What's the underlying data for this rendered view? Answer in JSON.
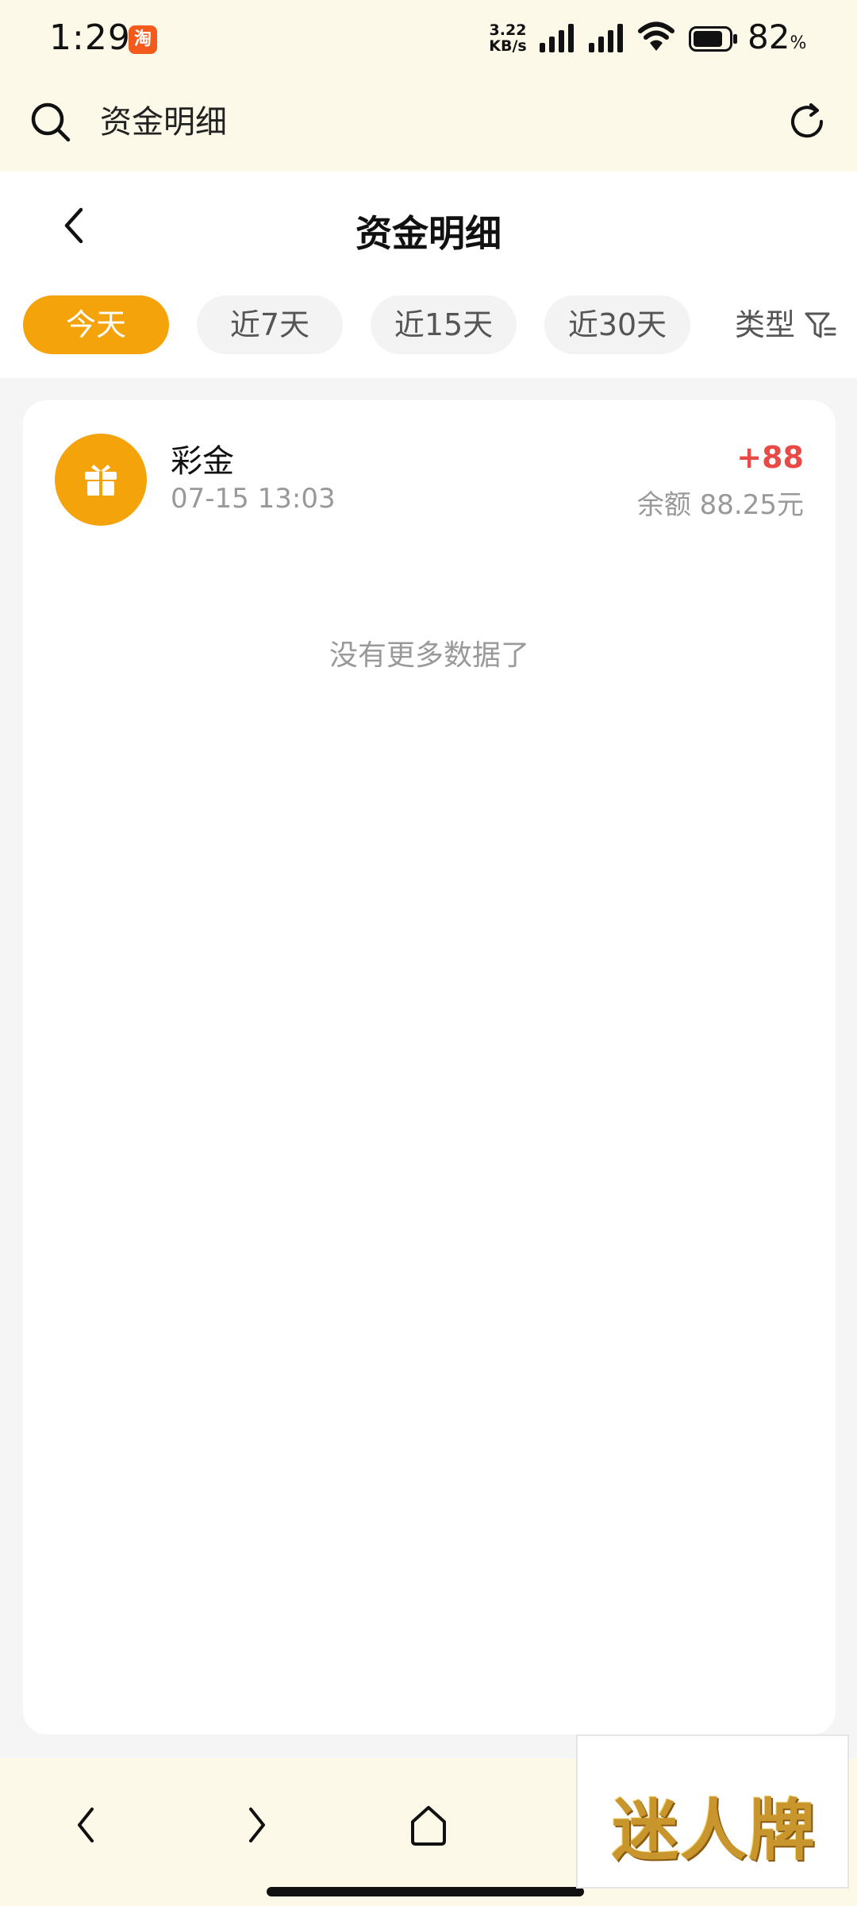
{
  "status_bar": {
    "time": "1:29",
    "app_badge": "淘",
    "net_speed_value": "3.22",
    "net_speed_unit": "KB/s",
    "battery_level": "82",
    "battery_unit": "%"
  },
  "browser": {
    "address_text": "资金明细"
  },
  "header": {
    "title": "资金明细"
  },
  "tabs": [
    {
      "label": "今天",
      "active": true
    },
    {
      "label": "近7天",
      "active": false
    },
    {
      "label": "近15天",
      "active": false
    },
    {
      "label": "近30天",
      "active": false
    }
  ],
  "filter": {
    "label": "类型"
  },
  "records": [
    {
      "name": "彩金",
      "time": "07-15 13:03",
      "amount": "+88",
      "balance": "余额 88.25元"
    }
  ],
  "list_end_text": "没有更多数据了",
  "watermark": {
    "text": "迷人牌"
  },
  "colors": {
    "accent": "#f5a30b",
    "amount_positive": "#e84b45",
    "cream": "#fdf9e9"
  },
  "icons": {
    "search": "search-icon",
    "refresh": "refresh-icon",
    "back": "chevron-left-icon",
    "filter": "filter-icon",
    "gift": "gift-icon",
    "forward": "chevron-right-icon",
    "home": "home-icon"
  }
}
